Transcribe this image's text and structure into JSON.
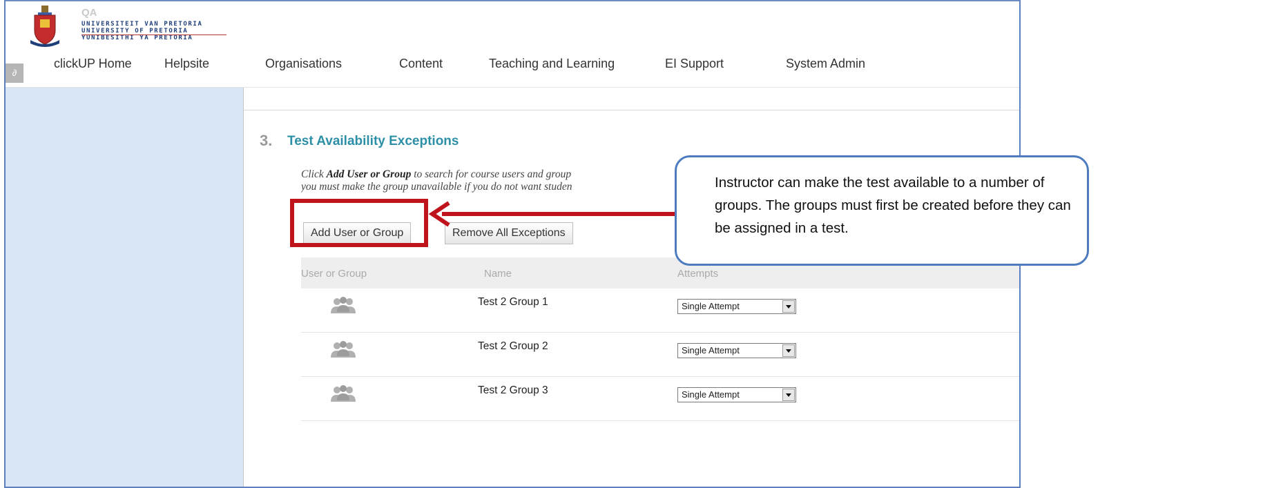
{
  "header": {
    "brand_short": "QA",
    "logo_lines": [
      "UNIVERSITEIT VAN PRETORIA",
      "UNIVERSITY OF PRETORIA",
      "YUNIBESITHI YA PRETORIA"
    ]
  },
  "nav": {
    "items": [
      {
        "label": "clickUP Home"
      },
      {
        "label": "Helpsite"
      },
      {
        "label": "Organisations"
      },
      {
        "label": "Content"
      },
      {
        "label": "Teaching and Learning"
      },
      {
        "label": "EI Support"
      },
      {
        "label": "System Admin"
      }
    ]
  },
  "section": {
    "number": "3.",
    "title": "Test Availability Exceptions",
    "instruction_line1_pre": "Click ",
    "instruction_line1_bold": "Add User or Group",
    "instruction_line1_post": " to search for course users and group",
    "instruction_line2": "you must make the group unavailable if you do not want studen"
  },
  "buttons": {
    "add_user_or_group": "Add User or Group",
    "remove_all_exceptions": "Remove All Exceptions"
  },
  "table": {
    "columns": [
      "User or Group",
      "Name",
      "Attempts"
    ],
    "rows": [
      {
        "name": "Test 2 Group 1",
        "attempts": "Single Attempt"
      },
      {
        "name": "Test 2 Group 2",
        "attempts": "Single Attempt"
      },
      {
        "name": "Test 2 Group 3",
        "attempts": "Single Attempt"
      }
    ]
  },
  "callout": {
    "text": "Instructor can make the test available to a number of groups. The groups must first be created before they can be assigned in a test."
  },
  "colors": {
    "accent_title": "#2d8fa6",
    "sidebar": "#d9e6f5",
    "annotation_red": "#c0141c",
    "callout_border": "#4d7bc0"
  },
  "icons": [
    "link-icon",
    "university-crest-icon",
    "group-icon",
    "dropdown-arrow-icon"
  ]
}
